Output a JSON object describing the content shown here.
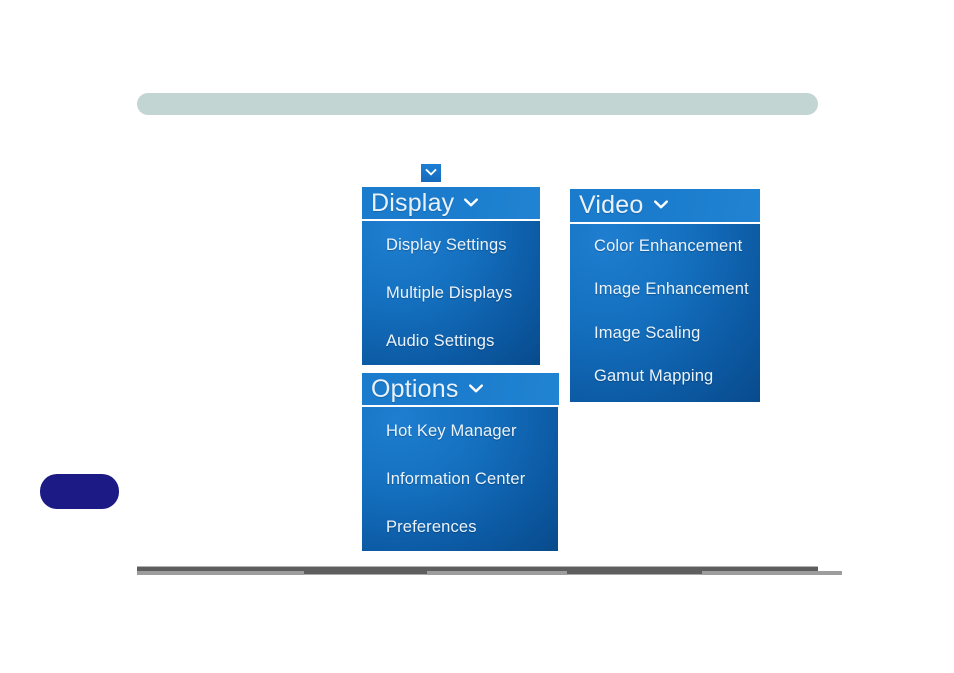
{
  "page": {
    "background_color": "#ffffff",
    "top_banner_color": "#c3d5d2",
    "bottom_rule_color": "#5e5e5e",
    "page_tab_color": "#1c1a84"
  },
  "chevron_badge": {
    "icon": "chevron-down-icon",
    "color": "#1569bb"
  },
  "menus": [
    {
      "id": "display",
      "title": "Display",
      "chevron_icon": "chevron-down-icon",
      "header_color": "#1b7ccd",
      "body_color": "#0c5aa4",
      "items": [
        {
          "label": "Display Settings"
        },
        {
          "label": "Multiple Displays"
        },
        {
          "label": "Audio Settings"
        }
      ]
    },
    {
      "id": "options",
      "title": "Options",
      "chevron_icon": "chevron-down-icon",
      "header_color": "#1b7ccd",
      "body_color": "#0c5aa4",
      "items": [
        {
          "label": "Hot Key Manager"
        },
        {
          "label": "Information Center"
        },
        {
          "label": "Preferences"
        }
      ]
    },
    {
      "id": "video",
      "title": "Video",
      "chevron_icon": "chevron-down-icon",
      "header_color": "#1b7ccd",
      "body_color": "#0c5aa4",
      "items": [
        {
          "label": "Color Enhancement"
        },
        {
          "label": "Image Enhancement"
        },
        {
          "label": "Image Scaling"
        },
        {
          "label": "Gamut Mapping"
        }
      ]
    }
  ]
}
